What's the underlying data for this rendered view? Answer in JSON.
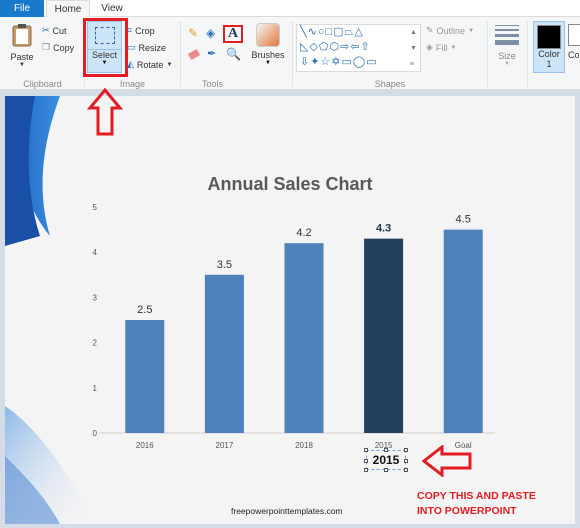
{
  "tabs": {
    "file": "File",
    "home": "Home",
    "view": "View"
  },
  "clipboard": {
    "paste": "Paste",
    "cut": "Cut",
    "copy": "Copy",
    "label": "Clipboard"
  },
  "image": {
    "select": "Select",
    "crop": "Crop",
    "resize": "Resize",
    "rotate": "Rotate",
    "label": "Image"
  },
  "tools": {
    "label": "Tools",
    "brushes": "Brushes"
  },
  "shapes": {
    "outline": "Outline",
    "fill": "Fill",
    "label": "Shapes"
  },
  "size": {
    "label": "Size"
  },
  "color": {
    "color1_line1": "Color",
    "color1_line2": "1",
    "color2": "Co",
    "color1_value": "#000000"
  },
  "annotation": {
    "line1": "COPY THIS AND PASTE",
    "line2": "INTO POWERPOINT",
    "selected_text": "2015"
  },
  "footer": "freepowerpointtemplates.com",
  "chart_data": {
    "type": "bar",
    "title": "Annual Sales Chart",
    "categories": [
      "2016",
      "2017",
      "2018",
      "2015",
      "Goal"
    ],
    "values": [
      2.5,
      3.5,
      4.2,
      4.3,
      4.5
    ],
    "value_labels": [
      "2.5",
      "3.5",
      "4.2",
      "4.3",
      "4.5"
    ],
    "highlight_index": 3,
    "colors": {
      "default": "#4f81bd",
      "highlight": "#253f5e"
    },
    "ylim": [
      0,
      5
    ],
    "yticks": [
      0,
      1,
      2,
      3,
      4,
      5
    ],
    "xlabel": "",
    "ylabel": "",
    "grid": false,
    "legend": "none"
  }
}
